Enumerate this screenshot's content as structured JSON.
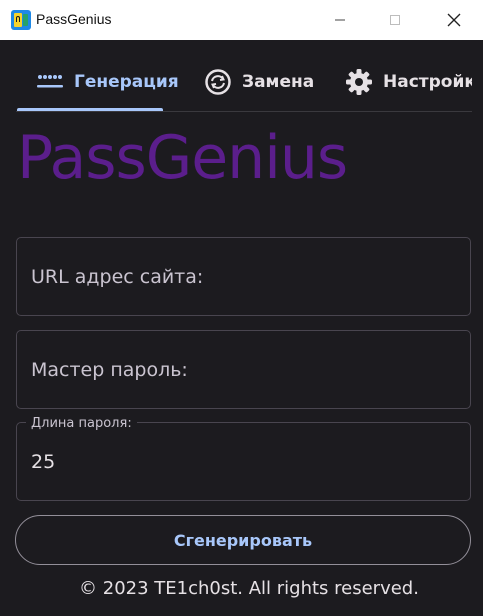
{
  "window": {
    "title": "PassGenius",
    "icon": "passgenius-app-icon",
    "controls": [
      "minimize-icon",
      "maximize-icon",
      "close-icon"
    ]
  },
  "tabs": [
    {
      "label": "Генерация",
      "icon": "password-dots-icon",
      "active": true
    },
    {
      "label": "Замена",
      "icon": "replace-cycle-icon",
      "active": false
    },
    {
      "label": "Настройки",
      "icon": "gear-icon",
      "active": false
    }
  ],
  "brand": {
    "text": "PassGenius",
    "color": "#5b1e8c"
  },
  "form": {
    "url_placeholder": "URL адрес сайта:",
    "master_placeholder": "Мастер пароль:",
    "length_label": "Длина пароля:",
    "length_value": "25"
  },
  "actions": {
    "generate_label": "Сгенерировать"
  },
  "footer": {
    "text": "© 2023 TE1ch0st. All rights reserved."
  },
  "colors": {
    "background": "#1c1b1f",
    "accent": "#a8c7fa",
    "brand": "#5b1e8c"
  }
}
